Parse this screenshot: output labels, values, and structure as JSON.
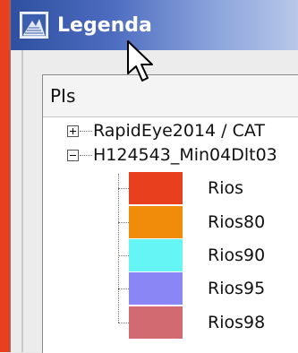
{
  "window": {
    "title": "Legenda"
  },
  "panel": {
    "header": "PIs",
    "tree": [
      {
        "label": "RapidEye2014 / CAT",
        "expanded": false
      },
      {
        "label": "H124543_Min04Dlt03",
        "expanded": true
      }
    ],
    "legend_items": [
      {
        "label": "Rios",
        "color": "#e8401f"
      },
      {
        "label": "Rios80",
        "color": "#f08c0a"
      },
      {
        "label": "Rios90",
        "color": "#66f5f5"
      },
      {
        "label": "Rios95",
        "color": "#8a86f5"
      },
      {
        "label": "Rios98",
        "color": "#d26a72"
      }
    ]
  }
}
